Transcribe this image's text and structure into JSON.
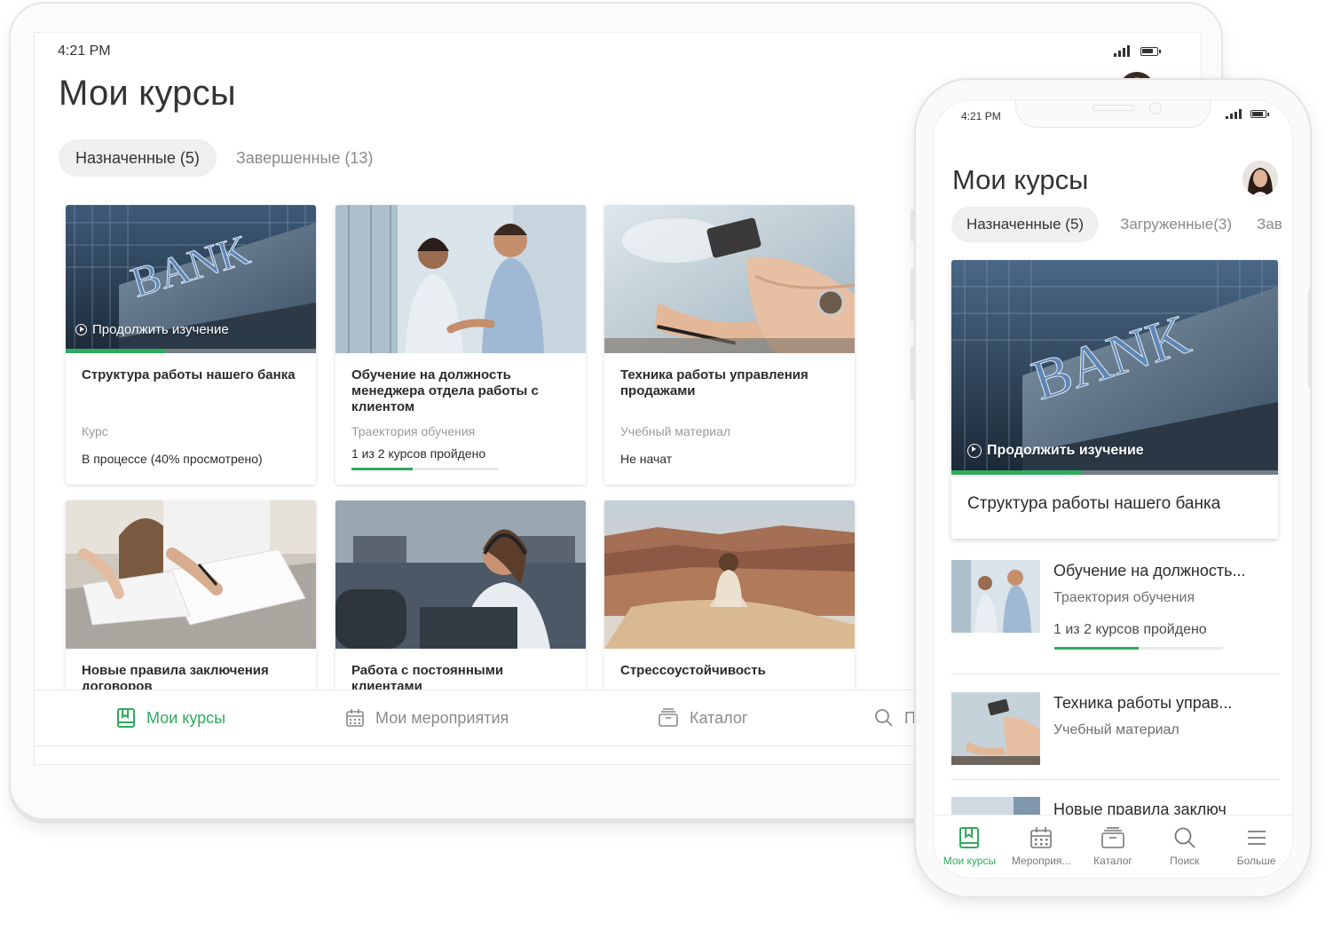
{
  "tablet": {
    "status_time": "4:21 PM",
    "title": "Мои курсы",
    "tabs": [
      {
        "label": "Назначенные (5)",
        "active": true
      },
      {
        "label": "Завершенные (13)",
        "active": false
      }
    ],
    "cards": [
      {
        "title": "Структура работы нашего банка",
        "type": "Курс",
        "status": "В процессе (40% просмотрено)",
        "continue_label": "Продолжить изучение",
        "progress": 0.4,
        "image": "bank-building"
      },
      {
        "title": "Обучение на должность менеджера отдела работы с клиентом",
        "type": "Траектория обучения",
        "status": "1 из 2 курсов пройдено",
        "progress": 0.42,
        "image": "handshake"
      },
      {
        "title": "Техника работы управления продажами",
        "type": "Учебный материал",
        "status": "Не начат",
        "image": "credit-card"
      },
      {
        "title": "Новые правила заключения договоров",
        "image": "signing-documents"
      },
      {
        "title": "Работа с постоянными клиентами",
        "image": "call-center"
      },
      {
        "title": "Стрессоустойчивость",
        "image": "canyon-meditation"
      }
    ],
    "nav": [
      {
        "label": "Мои курсы",
        "icon": "book-icon",
        "active": true
      },
      {
        "label": "Мои мероприятия",
        "icon": "calendar-icon",
        "active": false
      },
      {
        "label": "Каталог",
        "icon": "catalog-icon",
        "active": false
      },
      {
        "label": "По",
        "icon": "search-icon",
        "active": false
      }
    ]
  },
  "phone": {
    "status_time": "4:21 PM",
    "title": "Мои курсы",
    "tabs": [
      {
        "label": "Назначенные (5)",
        "active": true
      },
      {
        "label": "Загруженные(3)",
        "active": false
      },
      {
        "label": "Зав",
        "active": false
      }
    ],
    "featured": {
      "title": "Структура работы нашего банка",
      "continue_label": "Продолжить изучение",
      "progress": 0.4,
      "image": "bank-building"
    },
    "items": [
      {
        "title": "Обучение на должность...",
        "type": "Траектория обучения",
        "status": "1 из 2 курсов пройдено",
        "progress": 0.5,
        "image": "handshake"
      },
      {
        "title": "Техника работы управ...",
        "type": "Учебный материал",
        "image": "credit-card"
      },
      {
        "title": "Новые правила заключ",
        "image": "signing-documents"
      }
    ],
    "nav": [
      {
        "label": "Мои курсы",
        "icon": "book-icon",
        "active": true
      },
      {
        "label": "Мероприя...",
        "icon": "calendar-icon",
        "active": false
      },
      {
        "label": "Каталог",
        "icon": "catalog-icon",
        "active": false
      },
      {
        "label": "Поиск",
        "icon": "search-icon",
        "active": false
      },
      {
        "label": "Больше",
        "icon": "menu-icon",
        "active": false
      }
    ]
  },
  "colors": {
    "accent": "#2eab5e",
    "muted_text": "#8a8a8a",
    "pill_bg": "#efefef"
  }
}
